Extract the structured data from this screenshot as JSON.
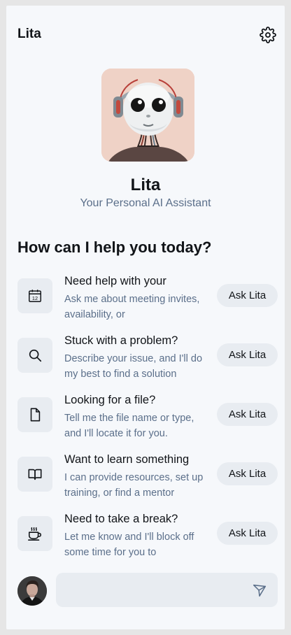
{
  "header": {
    "title": "Lita",
    "settings_icon": "gear-icon"
  },
  "assistant": {
    "name": "Lita",
    "subtitle": "Your Personal AI Assistant",
    "avatar_icon": "robot-avatar"
  },
  "main": {
    "heading": "How can I help you today?",
    "suggestions": [
      {
        "icon": "calendar-icon",
        "title": "Need help with your",
        "desc": "Ask me about meeting invites, availability, or",
        "button": "Ask Lita"
      },
      {
        "icon": "search-icon",
        "title": "Stuck with a problem?",
        "desc": "Describe your issue, and I'll do my best to find a solution",
        "button": "Ask Lita"
      },
      {
        "icon": "file-icon",
        "title": "Looking for a file?",
        "desc": "Tell me the file name or type, and I'll locate it for you.",
        "button": "Ask Lita"
      },
      {
        "icon": "book-icon",
        "title": "Want to learn something",
        "desc": "I can provide resources, set up training, or find a mentor",
        "button": "Ask Lita"
      },
      {
        "icon": "coffee-icon",
        "title": "Need to take a break?",
        "desc": "Let me know and I'll block off some time for you to",
        "button": "Ask Lita"
      }
    ]
  },
  "composer": {
    "input_value": "",
    "placeholder": "",
    "send_icon": "send-icon",
    "user_avatar": "user-avatar"
  },
  "colors": {
    "background": "#f6f8fb",
    "card": "#e8ecf1",
    "text": "#111418",
    "muted": "#5b6f8a",
    "avatar_bg": "#efd2c6"
  }
}
